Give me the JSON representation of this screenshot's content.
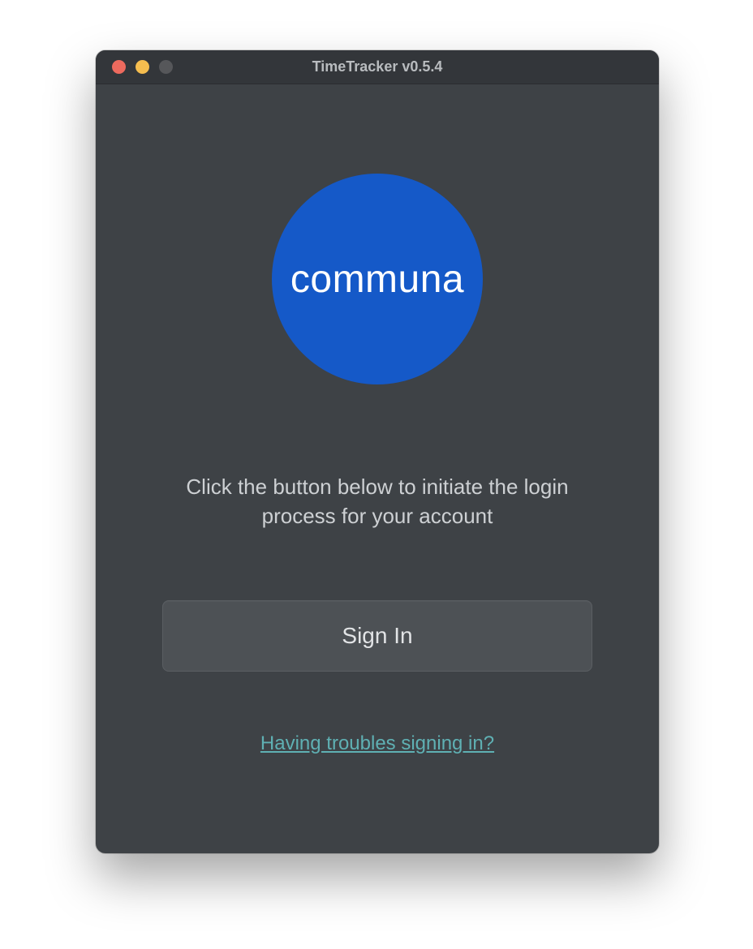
{
  "window": {
    "title": "TimeTracker v0.5.4"
  },
  "logo": {
    "text": "communa"
  },
  "main": {
    "instruction": "Click the button below to initiate the login process for your account",
    "signin_label": "Sign In",
    "help_link": "Having troubles signing in?"
  },
  "colors": {
    "window_bg": "#3e4246",
    "titlebar_bg": "#33363a",
    "logo_bg": "#1559c8",
    "button_bg": "#4d5155",
    "link_color": "#5fb0b3"
  }
}
